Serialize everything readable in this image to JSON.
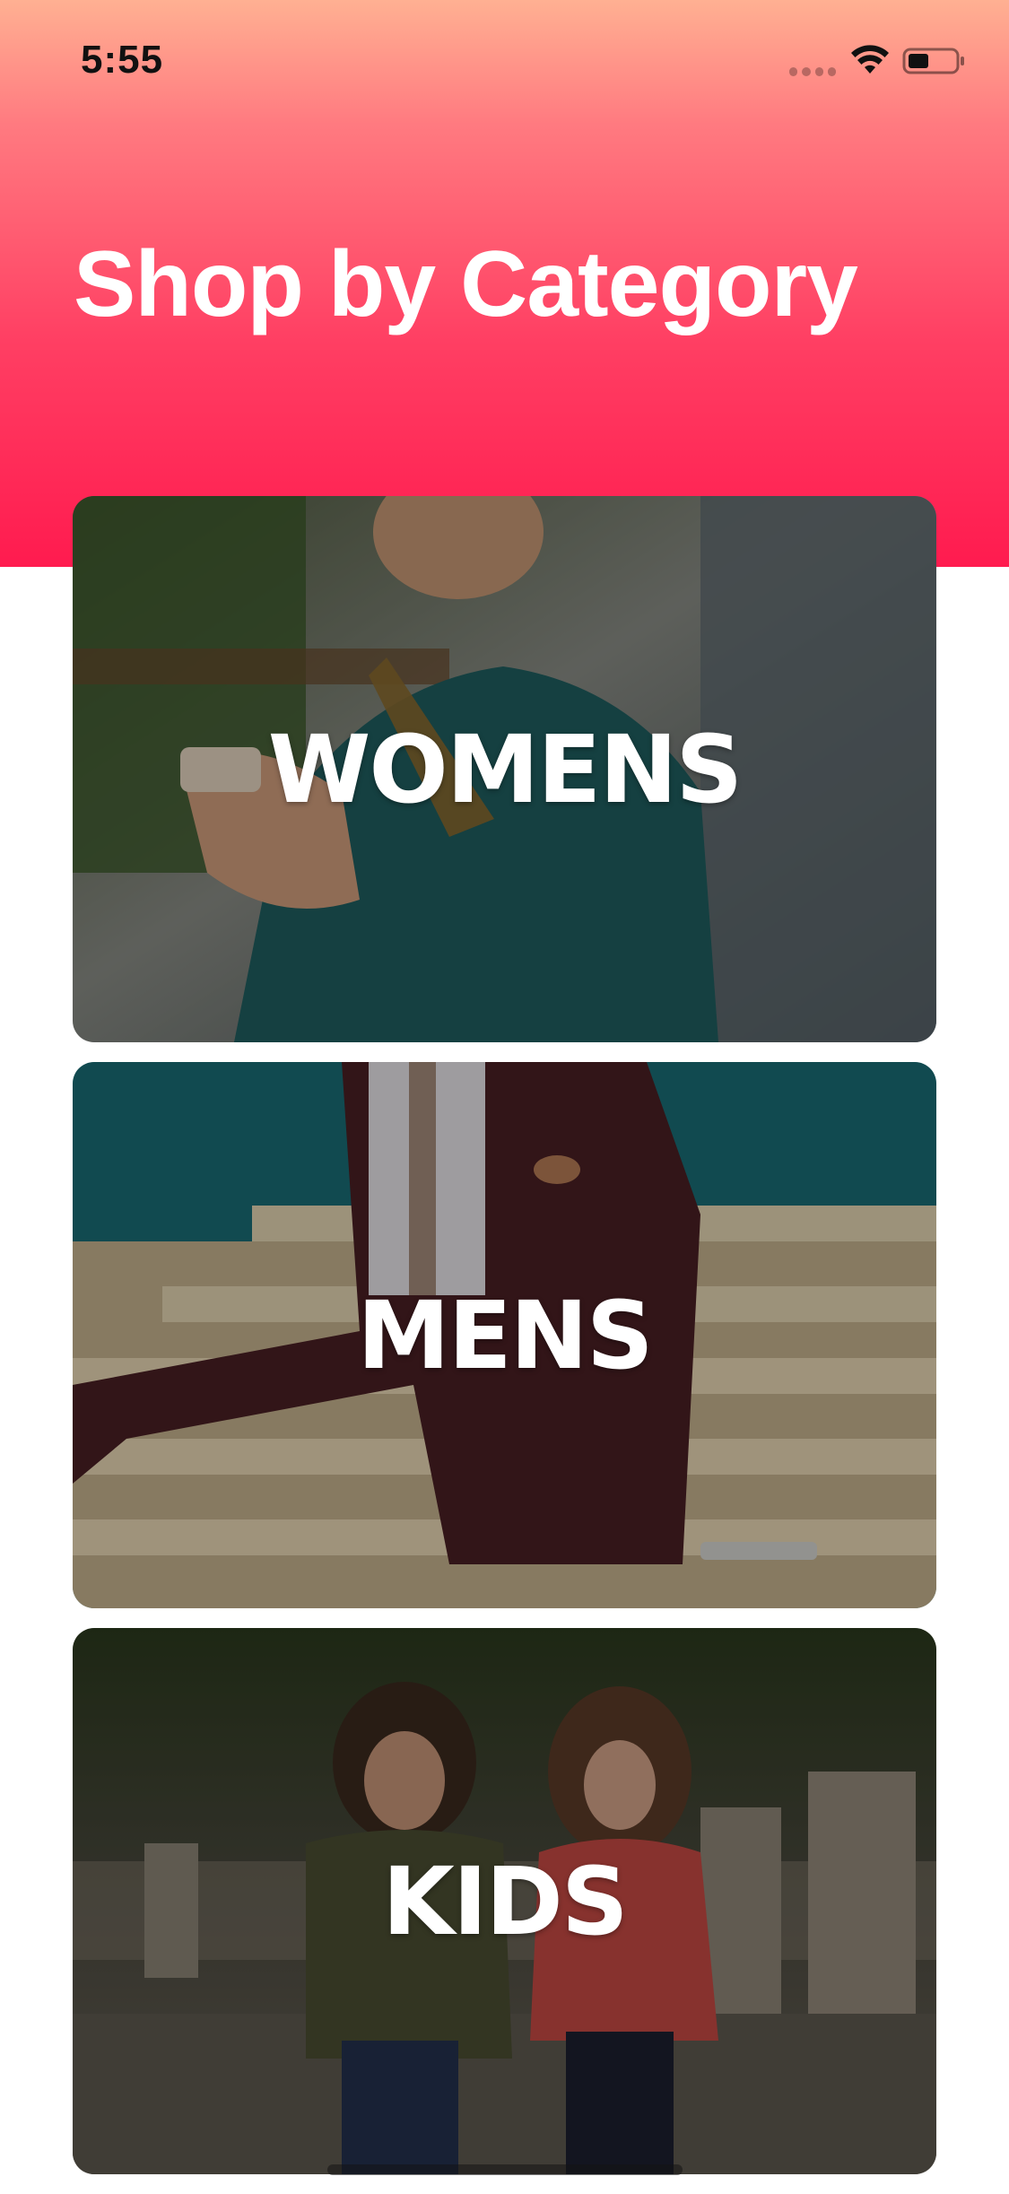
{
  "status_bar": {
    "time": "5:55",
    "icons": [
      "signal-icon",
      "wifi-icon",
      "battery-icon"
    ]
  },
  "header": {
    "title": "Shop by Category",
    "gradient_colors": [
      "#ffb092",
      "#ff7a80",
      "#ff3f63",
      "#ff1b4f"
    ]
  },
  "categories": [
    {
      "label": "WOMENS",
      "image": "woman-in-teal-shirt-holding-phone-photo"
    },
    {
      "label": "MENS",
      "image": "man-in-burgundy-suit-sitting-on-steps-photo"
    },
    {
      "label": "KIDS",
      "image": "two-children-standing-by-fence-photo"
    }
  ],
  "colors": {
    "title_text": "#ffffff",
    "card_label_text": "#ffffff",
    "background": "#ffffff"
  }
}
